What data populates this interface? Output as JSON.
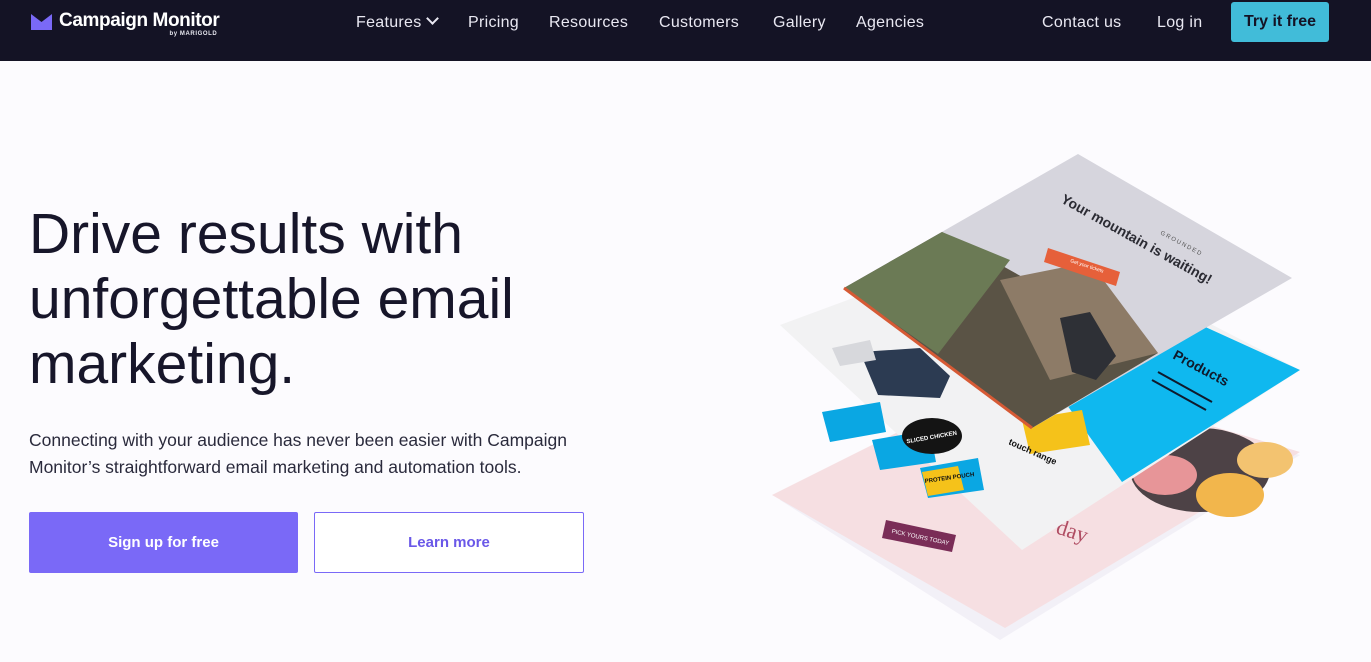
{
  "brand": {
    "name": "Campaign Monitor",
    "byline": "by MARIGOLD",
    "mark_color": "#7a69f7"
  },
  "nav": {
    "features": "Features",
    "pricing": "Pricing",
    "resources": "Resources",
    "customers": "Customers",
    "gallery": "Gallery",
    "agencies": "Agencies",
    "contact": "Contact us",
    "login": "Log in",
    "cta": "Try it free"
  },
  "hero": {
    "title": "Drive results with unforgettable email marketing.",
    "subtitle": "Connecting with your audience has never been easier with Campaign Monitor’s straightforward email marketing and automation tools.",
    "primary_button": "Sign up for free",
    "secondary_button": "Learn more"
  },
  "illustration": {
    "layer_top": {
      "brand": "GROUNDED",
      "headline": "Your mountain is waiting!",
      "button": "Get your tickets"
    },
    "layer_middle": {
      "heading": "Products",
      "caption": "touch range",
      "pack_1": "PROTEIN POUCH",
      "pack_2": "SLICED CHICKEN"
    },
    "layer_bottom": {
      "button": "PICK YOURS TODAY",
      "script": "day"
    }
  },
  "colors": {
    "nav_bg": "#141325",
    "accent": "#7a69f7",
    "cta": "#41bcd9",
    "text": "#17162a"
  }
}
